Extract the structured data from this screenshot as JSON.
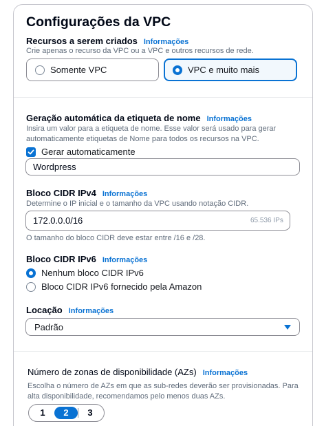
{
  "panel": {
    "title": "Configurações da VPC",
    "info_label": "Informações"
  },
  "resources": {
    "label": "Recursos a serem criados",
    "description": "Crie apenas o recurso da VPC ou a VPC e outros recursos de rede.",
    "options": [
      {
        "label": "Somente VPC",
        "selected": false
      },
      {
        "label": "VPC e muito mais",
        "selected": true
      }
    ]
  },
  "name_tag": {
    "label": "Geração automática da etiqueta de nome",
    "description_line1": "Insira um valor para a etiqueta de nome. Esse valor será usado para gerar",
    "description_line2": "automaticamente etiquetas de Nome para todos os recursos na VPC.",
    "auto_generate_label": "Gerar automaticamente",
    "auto_generate_checked": true,
    "value": "Wordpress"
  },
  "ipv4": {
    "label": "Bloco CIDR IPv4",
    "description": "Determine o IP inicial e o tamanho da VPC usando notação CIDR.",
    "value": "172.0.0.0/16",
    "suffix": "65.536 IPs",
    "constraint": "O tamanho do bloco CIDR deve estar entre /16 e /28."
  },
  "ipv6": {
    "label": "Bloco CIDR IPv6",
    "options": [
      {
        "label": "Nenhum bloco CIDR IPv6",
        "selected": true
      },
      {
        "label": "Bloco CIDR IPv6 fornecido pela Amazon",
        "selected": false
      }
    ]
  },
  "tenancy": {
    "label": "Locação",
    "value": "Padrão"
  },
  "azs": {
    "label": "Número de zonas de disponibilidade (AZs)",
    "description_line1": "Escolha o número de AZs em que as sub-redes deverão ser provisionadas. Para",
    "description_line2": "alta disponibilidade, recomendamos pelo menos duas AZs.",
    "options": [
      "1",
      "2",
      "3"
    ],
    "selected": "2"
  },
  "colors": {
    "accent": "#0972d3",
    "border": "#8c8c94",
    "text_secondary": "#5f6b7a"
  }
}
